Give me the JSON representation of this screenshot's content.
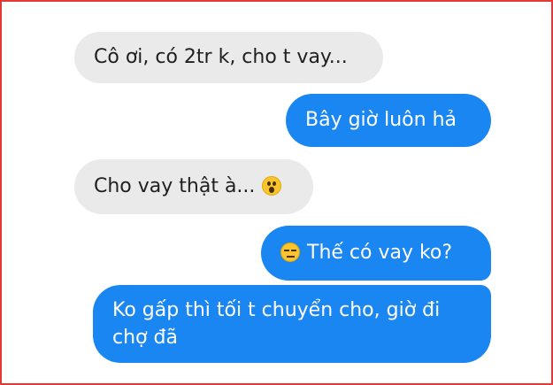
{
  "conversation": {
    "messages": [
      {
        "sender": "other",
        "text": "Cô ơi, có 2tr k, cho t vay..."
      },
      {
        "sender": "self",
        "text": "Bây giờ luôn hả"
      },
      {
        "sender": "other",
        "text": "Cho vay thật à...",
        "emoji": "astonished-face-icon"
      },
      {
        "sender": "self",
        "text": "Thế có vay ko?",
        "emoji": "expressionless-face-icon"
      },
      {
        "sender": "self",
        "text": "Ko gấp thì tối t chuyển cho, giờ đi chợ đã"
      }
    ]
  },
  "colors": {
    "incoming_bubble": "#eaeaea",
    "outgoing_bubble": "#1a86f2",
    "frame_border": "#e53935"
  }
}
